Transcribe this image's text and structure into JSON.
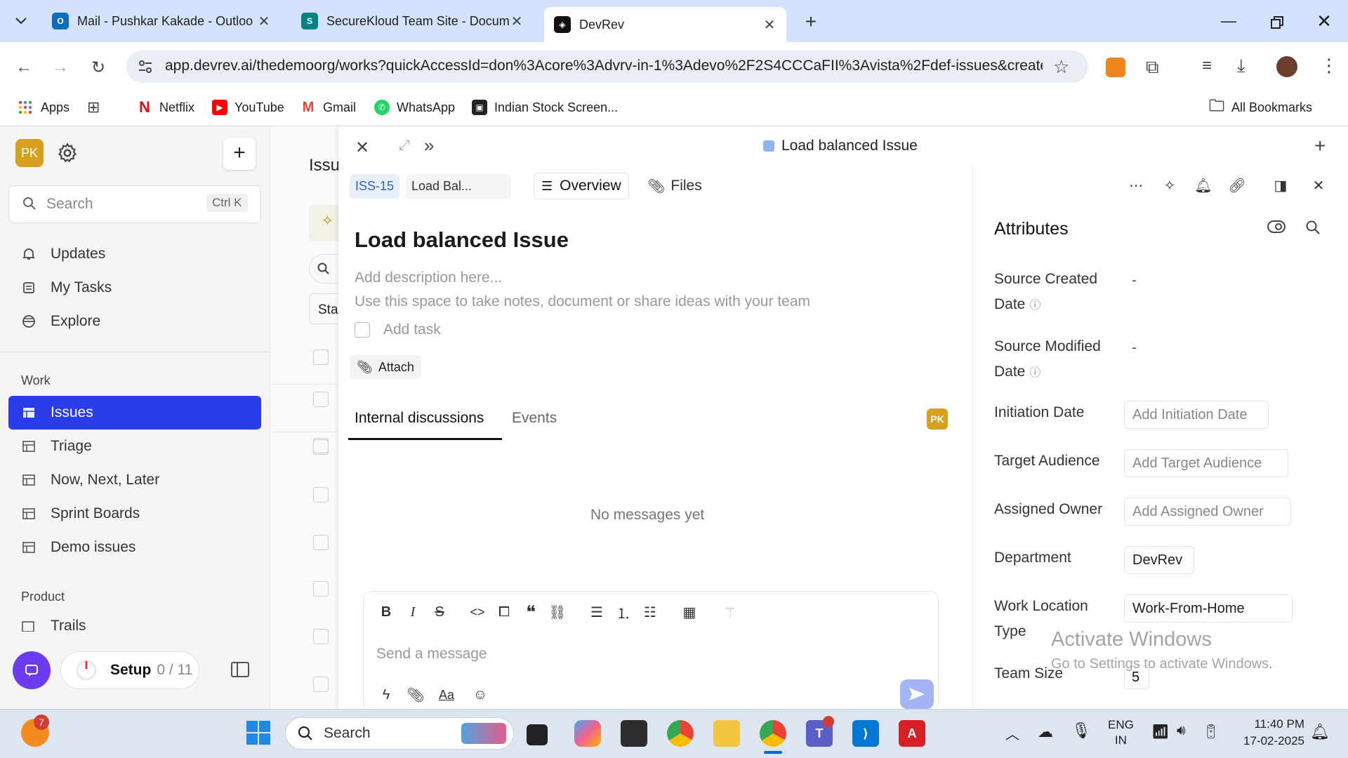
{
  "browser": {
    "tabs": [
      {
        "title": "Mail - Pushkar Kakade - Outloo",
        "active": false
      },
      {
        "title": "SecureKloud Team Site - Docum",
        "active": false
      },
      {
        "title": "DevRev",
        "active": true
      }
    ],
    "url": "app.devrev.ai/thedemoorg/works?quickAccessId=don%3Acore%3Advrv-in-1%3Adevo%2F2S4CCCaFII%3Avista%2Fdef-issues&create...",
    "bookmarks": [
      "Apps",
      "Netflix",
      "YouTube",
      "Gmail",
      "WhatsApp",
      "Indian Stock Screen...",
      "All Bookmarks"
    ]
  },
  "sidebar": {
    "avatar": "PK",
    "search_placeholder": "Search",
    "search_shortcut": "Ctrl K",
    "top_items": [
      "Updates",
      "My Tasks",
      "Explore"
    ],
    "work_section": "Work",
    "work_items": [
      "Issues",
      "Triage",
      "Now, Next, Later",
      "Sprint Boards",
      "Demo issues"
    ],
    "product_section": "Product",
    "product_items": [
      "Trails"
    ],
    "setup_label": "Setup",
    "setup_progress": "0 / 11"
  },
  "list": {
    "title_fragment": "Issu",
    "filter_fragment": "Sta"
  },
  "panel": {
    "header_title": "Load balanced Issue",
    "issue_id": "ISS-15",
    "issue_short": "Load Bal...",
    "tabs": [
      "Overview",
      "Files"
    ],
    "title": "Load balanced Issue",
    "description_placeholder": "Add description here...",
    "description_hint": "Use this space to take notes, document or share ideas with your team",
    "add_task": "Add task",
    "attach": "Attach",
    "discussion_tabs": [
      "Internal discussions",
      "Events"
    ],
    "participant": "PK",
    "empty_state": "No messages yet",
    "composer_placeholder": "Send a message",
    "composer_font_icon": "Aa"
  },
  "attributes": {
    "heading": "Attributes",
    "rows": [
      {
        "label_1": "Source Created",
        "label_2": "Date",
        "value": "-"
      },
      {
        "label_1": "Source Modified",
        "label_2": "Date",
        "value": "-"
      },
      {
        "label": "Initiation Date",
        "placeholder": "Add Initiation Date"
      },
      {
        "label": "Target Audience",
        "placeholder": "Add Target Audience"
      },
      {
        "label": "Assigned Owner",
        "placeholder": "Add Assigned Owner"
      },
      {
        "label": "Department",
        "value": "DevRev"
      },
      {
        "label_1": "Work Location",
        "label_2": "Type",
        "value": "Work-From-Home"
      },
      {
        "label": "Team Size",
        "value": "5"
      }
    ]
  },
  "watermark": {
    "line1": "Activate Windows",
    "line2": "Go to Settings to activate Windows."
  },
  "taskbar": {
    "search_label": "Search",
    "language_1": "ENG",
    "language_2": "IN",
    "time": "11:40 PM",
    "date": "17-02-2025",
    "badge_count": "7"
  },
  "colors": {
    "accent": "#2b3dea",
    "avatar_bg": "#d5a11e",
    "tabbar": "#d3e3fd"
  }
}
